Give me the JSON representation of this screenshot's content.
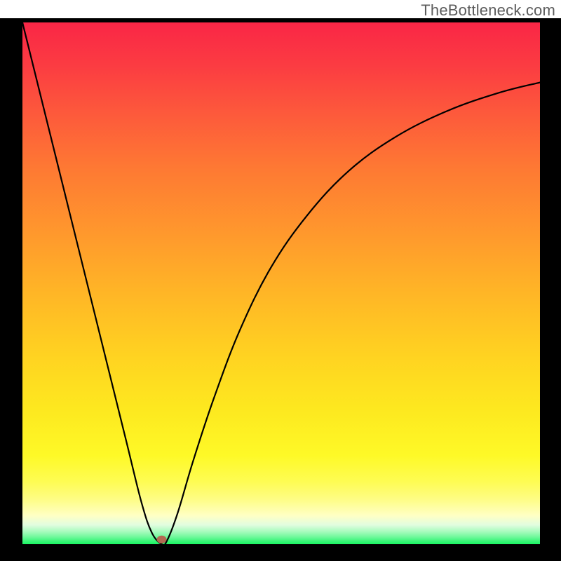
{
  "attribution": "TheBottleneck.com",
  "chart_data": {
    "type": "line",
    "title": "",
    "xlabel": "",
    "ylabel": "",
    "x_range": [
      0,
      100
    ],
    "y_range": [
      0,
      100
    ],
    "series": [
      {
        "name": "bottleneck-curve",
        "x": [
          0,
          5,
          10,
          15,
          20,
          23,
          25,
          26.9,
          27.9,
          30,
          33,
          37,
          42,
          48,
          55,
          63,
          72,
          82,
          92,
          100
        ],
        "values": [
          100,
          80,
          60,
          40,
          20,
          8,
          2.2,
          0.0,
          0.6,
          6,
          16,
          28,
          41,
          53,
          63,
          71.5,
          78,
          83,
          86.5,
          88.5
        ]
      }
    ],
    "marker": {
      "name": "bottleneck-point",
      "x": 26.9,
      "y": 0.9,
      "color": "#b36a52"
    },
    "gradient_stops": [
      {
        "pos": 0,
        "color": "#fa2646"
      },
      {
        "pos": 50,
        "color": "#ffb626"
      },
      {
        "pos": 85,
        "color": "#fefc53"
      },
      {
        "pos": 100,
        "color": "#19f662"
      }
    ]
  }
}
